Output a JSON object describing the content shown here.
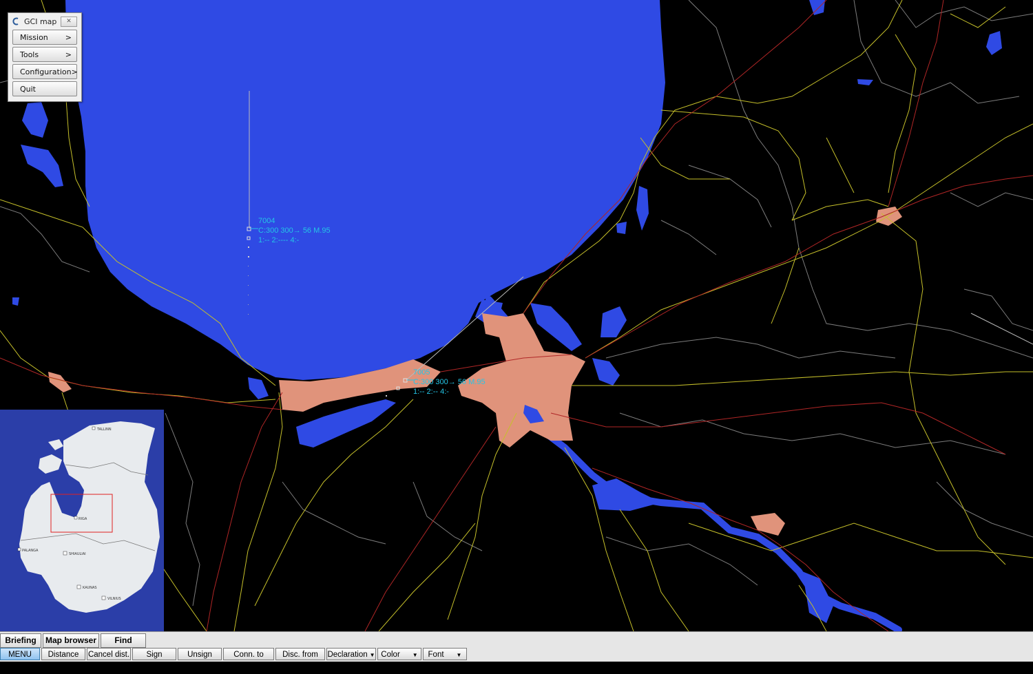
{
  "window": {
    "title": "GCI map"
  },
  "menu": {
    "items": [
      {
        "label": "Mission",
        "arrow": ">"
      },
      {
        "label": "Tools",
        "arrow": ">"
      },
      {
        "label": "Configuration",
        "arrow": ">"
      },
      {
        "label": "Quit",
        "arrow": ""
      }
    ]
  },
  "tracks": [
    {
      "id": "7004",
      "line1": "C:300 300→ 56 M.95",
      "line2": "1:-- 2:---- 4:-"
    },
    {
      "id": "7005",
      "line1": "C:300 300→ 56 M.95",
      "line2": "1:-- 2:-- 4:-"
    }
  ],
  "minimap": {
    "cities": [
      "TALLINN",
      "RIGA",
      "PALANGA",
      "SHIAULIAI",
      "KAUNAS",
      "VILNIUS"
    ]
  },
  "tabs": [
    "Briefing",
    "Map browser",
    "Find"
  ],
  "toolbar": {
    "buttons": [
      {
        "label": "MENU",
        "dropdown": false,
        "active": true
      },
      {
        "label": "Distance",
        "dropdown": false,
        "active": false
      },
      {
        "label": "Cancel dist.",
        "dropdown": false,
        "active": false
      },
      {
        "label": "Sign",
        "dropdown": false,
        "active": false
      },
      {
        "label": "Unsign",
        "dropdown": false,
        "active": false
      },
      {
        "label": "Conn. to BE",
        "dropdown": true,
        "active": false
      },
      {
        "label": "Disc. from BE",
        "dropdown": false,
        "active": false
      },
      {
        "label": "Declaration",
        "dropdown": true,
        "active": false
      },
      {
        "label": "Color",
        "dropdown": true,
        "active": false
      },
      {
        "label": "Font",
        "dropdown": true,
        "active": false
      }
    ]
  },
  "colors": {
    "water": "#2f4ae4",
    "urban": "#e0937b",
    "roads_major": "#c6c02a",
    "rail": "#b02626",
    "borders": "#7d7d7d",
    "track": "#24c5e6",
    "land": "#000000",
    "minimap_land": "#e8ebee",
    "minimap_sea": "#2b3ea8"
  }
}
